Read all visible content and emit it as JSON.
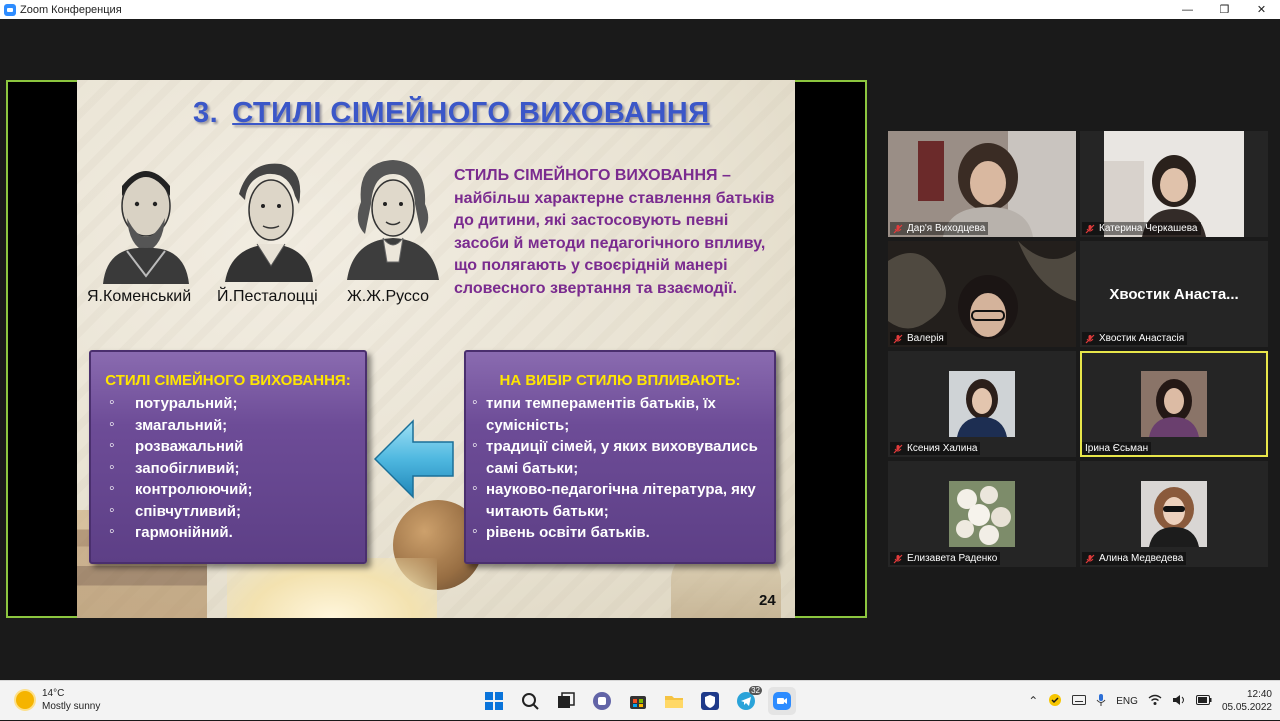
{
  "window": {
    "title": "Zoom Конференция",
    "minimize_label": "—",
    "restore_label": "❐",
    "close_label": "✕"
  },
  "slide": {
    "title_number": "3.",
    "title_text": "СТИЛІ СІМЕЙНОГО ВИХОВАННЯ",
    "portraits": [
      {
        "caption": "Я.Коменський"
      },
      {
        "caption": "Й.Песталоцці"
      },
      {
        "caption": "Ж.Ж.Руссо"
      }
    ],
    "definition_lead": "СТИЛЬ СІМЕЙНОГО ВИХОВАННЯ –",
    "definition_body": "найбільш характерне ставлення батьків до дитини, які застосовують певні засоби й методи педагогічного впливу, що полягають у своєрідній манері словесного звертання та взаємодії.",
    "left_box": {
      "title": "СТИЛІ СІМЕЙНОГО ВИХОВАННЯ:",
      "items": [
        "потуральний;",
        "змагальний;",
        "розважальний",
        "запобігливий;",
        "контролюючий;",
        "співчутливий;",
        "гармонійний."
      ]
    },
    "right_box": {
      "title": "НА ВИБІР СТИЛЮ ВПЛИВАЮТЬ:",
      "items": [
        "типи темпераментів батьків, їх сумісність;",
        "традиції сімей, у яких виховувались самі батьки;",
        "науково-педагогічна література, яку читають батьки;",
        "рівень освіти батьків."
      ]
    },
    "page_number": "24"
  },
  "participants": [
    {
      "name": "Дар'я Виходцева",
      "muted": true,
      "video": "photo"
    },
    {
      "name": "Катерина Черкашева",
      "muted": true,
      "video": "photo"
    },
    {
      "name": "Валерія",
      "muted": true,
      "video": "photo"
    },
    {
      "name": "Хвостик Анастасія",
      "muted": true,
      "video": "off",
      "display_name": "Хвостик Анаста..."
    },
    {
      "name": "Ксения Халина",
      "muted": true,
      "video": "avatar"
    },
    {
      "name": "Ірина Єсьман",
      "muted": false,
      "video": "avatar",
      "active_speaker": true
    },
    {
      "name": "Елизавета Раденко",
      "muted": true,
      "video": "avatar"
    },
    {
      "name": "Алина Медведева",
      "muted": true,
      "video": "avatar"
    }
  ],
  "taskbar": {
    "weather_temp": "14°C",
    "weather_desc": "Mostly sunny",
    "language": "ENG",
    "time": "12:40",
    "date": "05.05.2022",
    "apps": [
      "start-icon",
      "search-icon",
      "task-view-icon",
      "teams-icon",
      "store-icon",
      "explorer-icon",
      "vpn-icon",
      "telegram-icon",
      "zoom-icon"
    ],
    "telegram_badge": "32"
  }
}
